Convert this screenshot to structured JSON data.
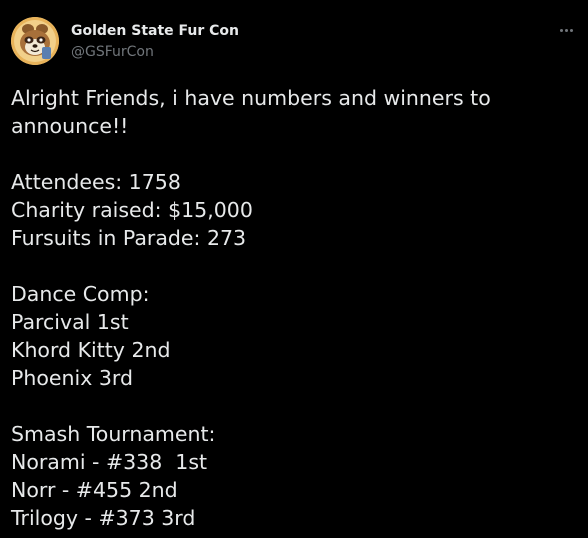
{
  "author": {
    "name": "Golden State Fur Con",
    "handle": "@GSFurCon",
    "avatar_icon": "tanuki-mascot-avatar"
  },
  "menu": {
    "icon": "more-horizontal-icon"
  },
  "tweet": {
    "intro_1": "Alright Friends, i have numbers and winners to",
    "intro_2": "announce!!",
    "stats": {
      "attendees": "Attendees: 1758",
      "charity": "Charity raised: $15,000",
      "fursuits": "Fursuits in Parade: 273"
    },
    "dance": {
      "heading": "Dance Comp:",
      "first": "Parcival 1st",
      "second": "Khord Kitty 2nd",
      "third": "Phoenix 3rd"
    },
    "smash": {
      "heading": "Smash Tournament:",
      "first": "Norami - #338  1st",
      "second": "Norr - #455 2nd",
      "third": "Trilogy - #373 3rd"
    }
  },
  "colors": {
    "background": "#000000",
    "text": "#e7e9ea",
    "muted": "#71767b"
  }
}
